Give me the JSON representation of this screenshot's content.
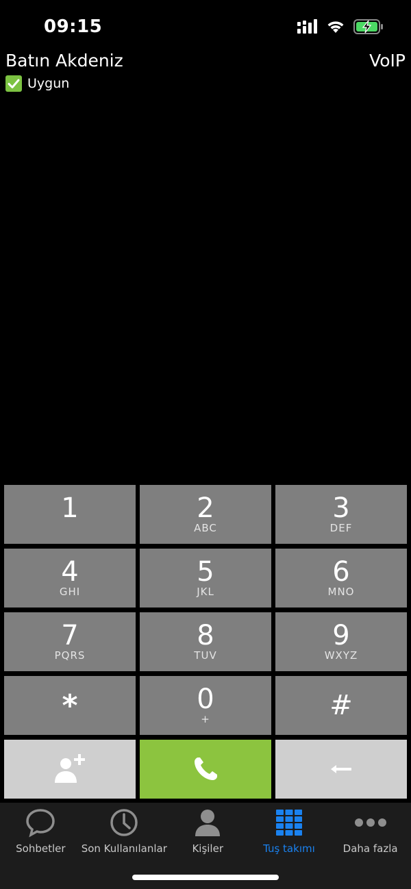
{
  "status_bar": {
    "time": "09:15"
  },
  "header": {
    "account_name": "Batın Akdeniz",
    "mode": "VoIP",
    "presence": "Uygun"
  },
  "keypad": {
    "keys": [
      {
        "digit": "1",
        "letters": ""
      },
      {
        "digit": "2",
        "letters": "ABC"
      },
      {
        "digit": "3",
        "letters": "DEF"
      },
      {
        "digit": "4",
        "letters": "GHI"
      },
      {
        "digit": "5",
        "letters": "JKL"
      },
      {
        "digit": "6",
        "letters": "MNO"
      },
      {
        "digit": "7",
        "letters": "PQRS"
      },
      {
        "digit": "8",
        "letters": "TUV"
      },
      {
        "digit": "9",
        "letters": "WXYZ"
      },
      {
        "digit": "*",
        "letters": ""
      },
      {
        "digit": "0",
        "letters": "+"
      },
      {
        "digit": "#",
        "letters": ""
      }
    ],
    "actions": {
      "add_contact": "add-contact-icon",
      "call": "phone-icon",
      "backspace": "backspace-arrow-icon"
    }
  },
  "tab_bar": {
    "tabs": [
      {
        "label": "Sohbetler",
        "icon": "chat-bubble-icon"
      },
      {
        "label": "Son Kullanılanlar",
        "icon": "clock-icon"
      },
      {
        "label": "Kişiler",
        "icon": "person-icon"
      },
      {
        "label": "Tuş takımı",
        "icon": "keypad-grid-icon"
      },
      {
        "label": "Daha fazla",
        "icon": "more-dots-icon"
      }
    ],
    "active_tab": "Tuş takımı"
  },
  "colors": {
    "key_gray": "#7f7f7f",
    "key_light": "#cfcfcf",
    "call_green": "#8cc43f",
    "presence_green": "#7cc242",
    "active_blue": "#1a82f0",
    "tab_bar_bg": "#1c1c1c"
  }
}
